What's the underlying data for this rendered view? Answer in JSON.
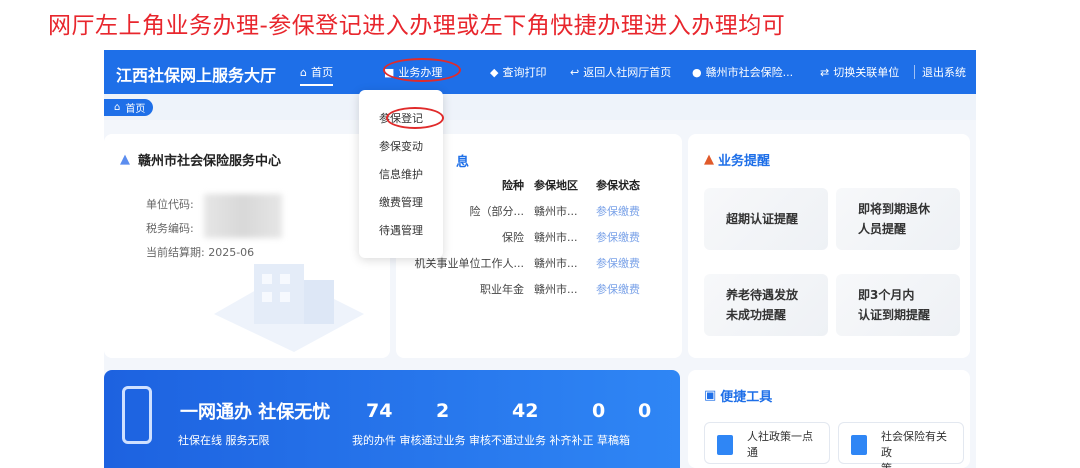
{
  "caption": "网厅左上角业务办理-参保登记进入办理或左下角快捷办理进入办理均可",
  "header": {
    "brand": "江西社保网上服务大厅",
    "nav": [
      {
        "label": "首页",
        "icon": "home-icon"
      },
      {
        "label": "业务办理",
        "icon": "briefcase-icon"
      },
      {
        "label": "查询打印",
        "icon": "print-icon"
      },
      {
        "label": "返回人社网厅首页",
        "icon": "back-icon"
      },
      {
        "label": "赣州市社会保险...",
        "icon": "user-icon"
      },
      {
        "label": "切换关联单位",
        "icon": "switch-icon"
      },
      {
        "label": "退出系统"
      }
    ]
  },
  "breadcrumb": {
    "label": "首页",
    "icon": "home-icon"
  },
  "dropdown": [
    "参保登记",
    "参保变动",
    "信息维护",
    "缴费管理",
    "待遇管理"
  ],
  "org_card": {
    "name": "赣州市社会保险服务中心",
    "unit_code_label": "单位代码:",
    "tax_code_label": "税务编码:",
    "period": "当前结算期: 2025-06"
  },
  "insurance_card": {
    "title_partial": "息",
    "headers": [
      "险种",
      "参保地区",
      "参保状态"
    ],
    "rows": [
      [
        "险（部分...",
        "赣州市...",
        "参保缴费"
      ],
      [
        "保险",
        "赣州市...",
        "参保缴费"
      ],
      [
        "机关事业单位工作人...",
        "赣州市...",
        "参保缴费"
      ],
      [
        "职业年金",
        "赣州市...",
        "参保缴费"
      ]
    ]
  },
  "reminders": {
    "title": "业务提醒",
    "items": [
      {
        "l1": "超期认证提醒",
        "l2": ""
      },
      {
        "l1": "即将到期退休",
        "l2": "人员提醒"
      },
      {
        "l1": "养老待遇发放",
        "l2": "未成功提醒"
      },
      {
        "l1": "即3个月内",
        "l2": "认证到期提醒"
      }
    ]
  },
  "banner": {
    "title": "一网通办 社保无忧",
    "subtitle": "社保在线 服务无限",
    "numbers": [
      "74",
      "2",
      "42",
      "0",
      "0"
    ],
    "labels": "我的办件 审核通过业务 审核不通过业务 补齐补正 草稿箱"
  },
  "tools": {
    "title": "便捷工具",
    "items": [
      {
        "l1": "人社政策一点",
        "l2": "通"
      },
      {
        "l1": "社会保险有关政",
        "l2": "策"
      }
    ]
  },
  "colors": {
    "primary": "#1e6fe8",
    "annotation": "#e02b2b"
  }
}
